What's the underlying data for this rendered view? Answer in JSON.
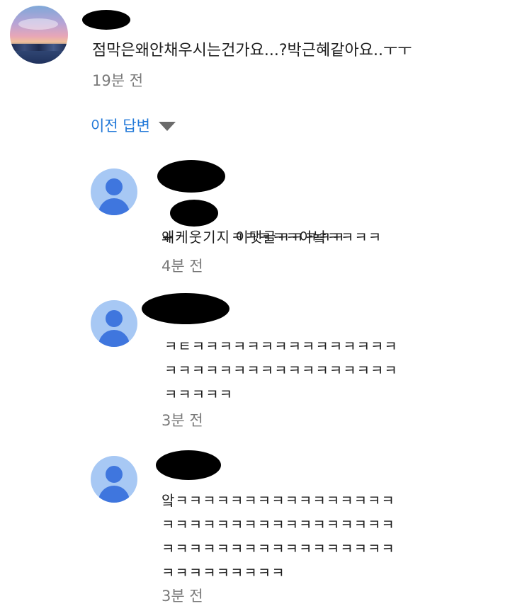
{
  "top_comment": {
    "text": "점막은왜안채우시는건가요...?박근혜같아요..ㅜㅜ",
    "time": "19분 전"
  },
  "show_replies_label": "이전 답변",
  "replies": [
    {
      "mention_prefix": "+",
      "text_after_mention": "ㅋㅋㅋㅋㅋ아놬ㅋㅋㅋㅋ",
      "text_line2": "왜케웃기지 이댓글ㅋㅋㅋㅋㅋ",
      "time": "4분 전"
    },
    {
      "text": "ㅋㅌㅋㅋㅋㅋㅋㅋㅋㅋㅋㅋㅋㅋㅋㅋㅋ\nㅋㅋㅋㅋㅋㅋㅋㅋㅋㅋㅋㅋㅋㅋㅋㅋㅋ\nㅋㅋㅋㅋㅋ",
      "time": "3분 전"
    },
    {
      "text": "앜ㅋㅋㅋㅋㅋㅋㅋㅋㅋㅋㅋㅋㅋㅋㅋㅋ\nㅋㅋㅋㅋㅋㅋㅋㅋㅋㅋㅋㅋㅋㅋㅋㅋㅋ\nㅋㅋㅋㅋㅋㅋㅋㅋㅋㅋㅋㅋㅋㅋㅋㅋㅋ\nㅋㅋㅋㅋㅋㅋㅋㅋㅋ",
      "time": "3분 전"
    }
  ]
}
